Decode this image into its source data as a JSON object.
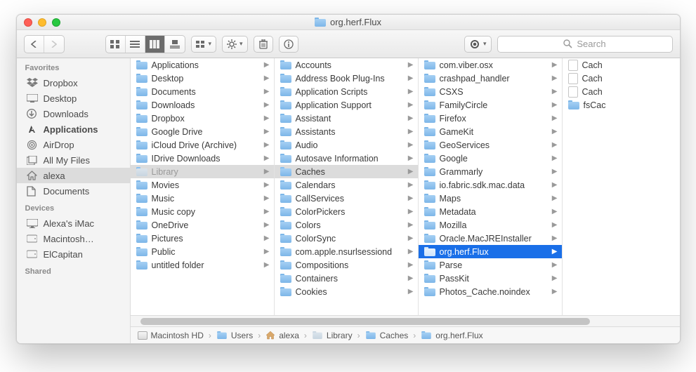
{
  "window": {
    "title": "org.herf.Flux"
  },
  "search": {
    "placeholder": "Search"
  },
  "sidebar": {
    "sections": [
      {
        "label": "Favorites",
        "items": [
          {
            "icon": "dropbox",
            "label": "Dropbox"
          },
          {
            "icon": "desktop",
            "label": "Desktop"
          },
          {
            "icon": "downloads",
            "label": "Downloads"
          },
          {
            "icon": "apps",
            "label": "Applications",
            "bold": true
          },
          {
            "icon": "airdrop",
            "label": "AirDrop"
          },
          {
            "icon": "allfiles",
            "label": "All My Files"
          },
          {
            "icon": "home",
            "label": "alexa",
            "selected": true
          },
          {
            "icon": "documents",
            "label": "Documents"
          }
        ]
      },
      {
        "label": "Devices",
        "items": [
          {
            "icon": "imac",
            "label": "Alexa's iMac"
          },
          {
            "icon": "hd",
            "label": "Macintosh…"
          },
          {
            "icon": "hd",
            "label": "ElCapitan"
          }
        ]
      },
      {
        "label": "Shared",
        "items": []
      }
    ]
  },
  "columns": [
    {
      "items": [
        {
          "label": "Applications",
          "arrow": true
        },
        {
          "label": "Desktop",
          "arrow": true
        },
        {
          "label": "Documents",
          "arrow": true
        },
        {
          "label": "Downloads",
          "arrow": true
        },
        {
          "label": "Dropbox",
          "arrow": true
        },
        {
          "label": "Google Drive",
          "arrow": true
        },
        {
          "label": "iCloud Drive (Archive)",
          "arrow": true
        },
        {
          "label": "IDrive Downloads",
          "arrow": true
        },
        {
          "label": "Library",
          "arrow": true,
          "selected": "gray",
          "dim": true
        },
        {
          "label": "Movies",
          "arrow": true
        },
        {
          "label": "Music",
          "arrow": true
        },
        {
          "label": "Music copy",
          "arrow": true
        },
        {
          "label": "OneDrive",
          "arrow": true
        },
        {
          "label": "Pictures",
          "arrow": true
        },
        {
          "label": "Public",
          "arrow": true
        },
        {
          "label": "untitled folder",
          "arrow": true
        }
      ]
    },
    {
      "items": [
        {
          "label": "Accounts",
          "arrow": true
        },
        {
          "label": "Address Book Plug-Ins",
          "arrow": true
        },
        {
          "label": "Application Scripts",
          "arrow": true
        },
        {
          "label": "Application Support",
          "arrow": true
        },
        {
          "label": "Assistant",
          "arrow": true
        },
        {
          "label": "Assistants",
          "arrow": true
        },
        {
          "label": "Audio",
          "arrow": true
        },
        {
          "label": "Autosave Information",
          "arrow": true
        },
        {
          "label": "Caches",
          "arrow": true,
          "selected": "gray"
        },
        {
          "label": "Calendars",
          "arrow": true
        },
        {
          "label": "CallServices",
          "arrow": true
        },
        {
          "label": "ColorPickers",
          "arrow": true
        },
        {
          "label": "Colors",
          "arrow": true
        },
        {
          "label": "ColorSync",
          "arrow": true
        },
        {
          "label": "com.apple.nsurlsessiond",
          "arrow": true
        },
        {
          "label": "Compositions",
          "arrow": true
        },
        {
          "label": "Containers",
          "arrow": true
        },
        {
          "label": "Cookies",
          "arrow": true
        }
      ]
    },
    {
      "items": [
        {
          "label": "com.viber.osx",
          "arrow": true
        },
        {
          "label": "crashpad_handler",
          "arrow": true
        },
        {
          "label": "CSXS",
          "arrow": true
        },
        {
          "label": "FamilyCircle",
          "arrow": true
        },
        {
          "label": "Firefox",
          "arrow": true
        },
        {
          "label": "GameKit",
          "arrow": true
        },
        {
          "label": "GeoServices",
          "arrow": true
        },
        {
          "label": "Google",
          "arrow": true
        },
        {
          "label": "Grammarly",
          "arrow": true
        },
        {
          "label": "io.fabric.sdk.mac.data",
          "arrow": true
        },
        {
          "label": "Maps",
          "arrow": true
        },
        {
          "label": "Metadata",
          "arrow": true
        },
        {
          "label": "Mozilla",
          "arrow": true
        },
        {
          "label": "Oracle.MacJREInstaller",
          "arrow": true
        },
        {
          "label": "org.herf.Flux",
          "arrow": true,
          "selected": "blue"
        },
        {
          "label": "Parse",
          "arrow": true
        },
        {
          "label": "PassKit",
          "arrow": true
        },
        {
          "label": "Photos_Cache.noindex",
          "arrow": true
        }
      ]
    },
    {
      "items": [
        {
          "label": "Cach",
          "type": "doc"
        },
        {
          "label": "Cach",
          "type": "doc"
        },
        {
          "label": "Cach",
          "type": "doc"
        },
        {
          "label": "fsCac",
          "type": "folder"
        }
      ]
    }
  ],
  "pathbar": [
    {
      "icon": "disk",
      "label": "Macintosh HD"
    },
    {
      "icon": "folder",
      "label": "Users"
    },
    {
      "icon": "home",
      "label": "alexa"
    },
    {
      "icon": "folderdim",
      "label": "Library"
    },
    {
      "icon": "folder",
      "label": "Caches"
    },
    {
      "icon": "folder",
      "label": "org.herf.Flux"
    }
  ]
}
